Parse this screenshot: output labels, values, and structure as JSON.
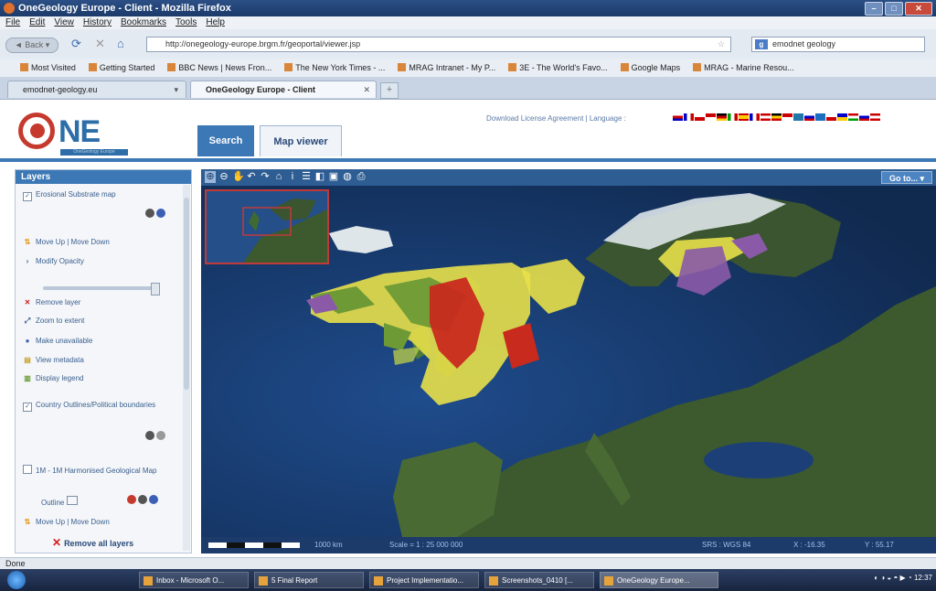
{
  "window": {
    "title": "OneGeology Europe - Client - Mozilla Firefox",
    "buttons": [
      "–",
      "□",
      "✕"
    ]
  },
  "menu": [
    "File",
    "Edit",
    "View",
    "History",
    "Bookmarks",
    "Tools",
    "Help"
  ],
  "nav": {
    "back_label": "◄ Back ▾",
    "url": "http://onegeology-europe.brgm.fr/geoportal/viewer.jsp",
    "search_value": "emodnet geology"
  },
  "bookmarks": [
    "Most Visited",
    "Getting Started",
    "BBC News | News Fron...",
    "The New York Times - ...",
    "MRAG Intranet - My P...",
    "3E - The World's Favo...",
    "Google Maps",
    "MRAG - Marine Resou..."
  ],
  "browser_tabs": [
    {
      "label": "emodnet-geology.eu",
      "active": false
    },
    {
      "label": "OneGeology Europe - Client",
      "active": true
    }
  ],
  "site": {
    "logo_text": "NE",
    "logo_subtitle": "OneGeology Europe",
    "tabs": [
      "Search",
      "Map viewer"
    ],
    "links": "Download License Agreement  |  Language :"
  },
  "layers": {
    "title": "Layers",
    "layer1": "Erosional Substrate map",
    "move": "Move Up | Move Down",
    "opacity": "Modify Opacity",
    "remove": "Remove layer",
    "zoom": "Zoom to extent",
    "unavailable": "Make unavailable",
    "metadata": "View metadata",
    "legend": "Display legend",
    "layer2": "Country Outlines/Political boundaries",
    "layer3": "1M - 1M Harmonised Geological Map",
    "style": "Outline",
    "move2": "Move Up | Move Down",
    "remove_all": "Remove all layers",
    "opacity_level": 1.0
  },
  "map": {
    "goto": "Go to... ▾",
    "scale_text": "1000 km",
    "scale": "Scale = 1 : 25 000 000",
    "srs": "SRS : WGS 84",
    "x": "X : -16.35",
    "y": "Y : 55.17",
    "colors": {
      "sea": "#1d3f78",
      "land": "#3c5a2e",
      "yellow": "#e8e04a",
      "red": "#c82a1e",
      "green": "#6e9a35",
      "purple": "#8a5aa8"
    }
  },
  "status": "Done",
  "taskbar": {
    "items": [
      "Inbox - Microsoft O...",
      "5 Final Report",
      "Project Implementatio...",
      "Screenshots_0410 [...",
      "OneGeology Europe..."
    ],
    "clock": "12:37"
  }
}
